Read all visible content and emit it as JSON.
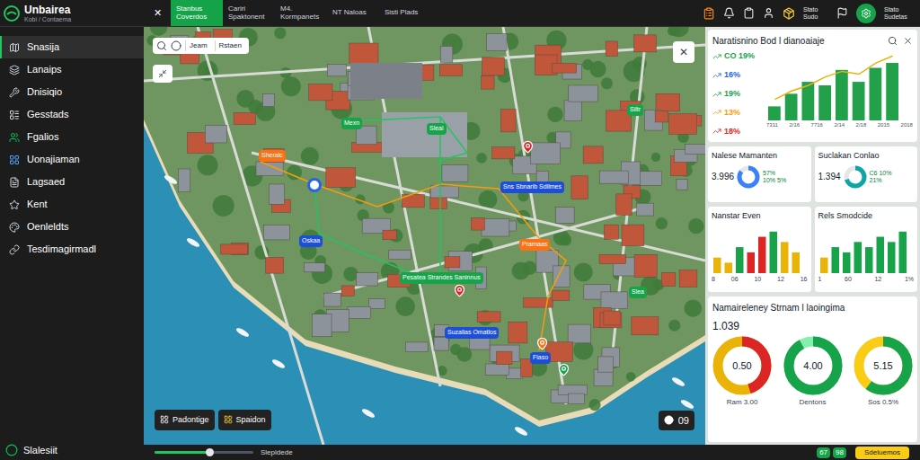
{
  "app": {
    "name": "Unbairea",
    "subtitle": "Kobi / Contaema"
  },
  "toolbar": {
    "close": "✕",
    "tabs": [
      {
        "label": "Stanbus Coverdos",
        "selected": true
      },
      {
        "label": "Cariri Spaktonent",
        "selected": false
      },
      {
        "label": "M4. Kormpanets",
        "selected": false
      },
      {
        "label": "NT Naloas",
        "selected": false
      },
      {
        "label": "Sisti Plads",
        "selected": false
      }
    ],
    "status": "Stato Sudo",
    "user": "Stato Sudetas"
  },
  "sidebar": {
    "items": [
      {
        "label": "Snasija",
        "selected": true
      },
      {
        "label": "Lanaips",
        "selected": false
      },
      {
        "label": "Dnisiqio",
        "selected": false
      },
      {
        "label": "Gesstads",
        "selected": false
      },
      {
        "label": "Fgalios",
        "selected": false
      },
      {
        "label": "Uonajiaman",
        "selected": false
      },
      {
        "label": "Lagsaed",
        "selected": false
      },
      {
        "label": "Kent",
        "selected": false
      },
      {
        "label": "Oenleldts",
        "selected": false
      },
      {
        "label": "Tesdimagirmadl",
        "selected": false
      }
    ],
    "footer": "Slalesiit"
  },
  "map": {
    "tools": [
      "Jeam",
      "Rstaen"
    ],
    "close": "✕",
    "labels": [
      {
        "text": "Sheraic",
        "color": "#f97316"
      },
      {
        "text": "Mexn",
        "color": "#16a34a"
      },
      {
        "text": "Sleal",
        "color": "#16a34a"
      },
      {
        "text": "Siltr",
        "color": "#16a34a"
      },
      {
        "text": "Sns Sbnarib Sdilmes",
        "color": "#1d4ed8"
      },
      {
        "text": "Prarnaas",
        "color": "#f97316"
      },
      {
        "text": "Oskaa",
        "color": "#1d4ed8"
      },
      {
        "text": "Pesatea Strandes Saninnus",
        "color": "#16a34a"
      },
      {
        "text": "Suzalias Omatlos",
        "color": "#1d4ed8"
      },
      {
        "text": "Fiaso",
        "color": "#1d4ed8"
      },
      {
        "text": "Slea",
        "color": "#16a34a"
      }
    ],
    "pins": [
      {
        "color": "#dc2626"
      },
      {
        "color": "#2563eb"
      },
      {
        "color": "#dc2626"
      },
      {
        "color": "#16a34a"
      },
      {
        "color": "#f97316"
      }
    ],
    "buttons": [
      "Padontige",
      "Spaidon"
    ],
    "counter": "09"
  },
  "panel": {
    "trend": {
      "title": "Naratisnino Bod l dianoaiaje",
      "legend": [
        {
          "label": "CO 19%",
          "color": "#16a34a"
        },
        {
          "label": "16%",
          "color": "#2563eb"
        },
        {
          "label": "19%",
          "color": "#16a34a"
        },
        {
          "label": "13%",
          "color": "#f59e0b"
        },
        {
          "label": "18%",
          "color": "#dc2626"
        }
      ],
      "bars": [
        20,
        38,
        55,
        50,
        72,
        55,
        75,
        82
      ],
      "line": [
        30,
        42,
        50,
        62,
        70,
        66,
        82,
        92
      ],
      "max": 100,
      "ticks": [
        "7311",
        "2/16",
        "7716",
        "2/14",
        "2/18",
        "2015",
        "2018"
      ]
    },
    "stats": [
      {
        "title": "Nalese Mamanten",
        "value": "3.996",
        "note": "57% 10% 5%",
        "level": 0.85,
        "color": "#3b82f6"
      },
      {
        "title": "Suclakan Conlao",
        "value": "1.394",
        "note": "C6 10% 21%",
        "level": 0.7,
        "color": "#0ea5a4"
      }
    ],
    "mini_charts": [
      {
        "title": "Nanstar Even",
        "bars": [
          {
            "value": 3,
            "color": "#eab308"
          },
          {
            "value": 2,
            "color": "#eab308"
          },
          {
            "value": 5,
            "color": "#16a34a"
          },
          {
            "value": 4,
            "color": "#dc2626"
          },
          {
            "value": 7,
            "color": "#dc2626"
          },
          {
            "value": 8,
            "color": "#16a34a"
          },
          {
            "value": 6,
            "color": "#eab308"
          },
          {
            "value": 4,
            "color": "#eab308"
          }
        ],
        "max": 9,
        "ticks": [
          "8",
          "06",
          "10",
          "12",
          "16"
        ]
      },
      {
        "title": "Rels Smodcide",
        "bars": [
          {
            "value": 3,
            "color": "#eab308"
          },
          {
            "value": 5,
            "color": "#16a34a"
          },
          {
            "value": 4,
            "color": "#16a34a"
          },
          {
            "value": 6,
            "color": "#16a34a"
          },
          {
            "value": 5,
            "color": "#16a34a"
          },
          {
            "value": 7,
            "color": "#16a34a"
          },
          {
            "value": 6,
            "color": "#16a34a"
          },
          {
            "value": 8,
            "color": "#16a34a"
          }
        ],
        "max": 9,
        "ticks": [
          "1",
          "60",
          "12",
          "1%"
        ]
      }
    ],
    "stream": {
      "title": "Namaireleney Strnam l laoingima",
      "value": "1.039",
      "donuts": [
        {
          "value": "0.50",
          "caption": "Ram 3.00",
          "level": 0.45,
          "color": "#dc2626",
          "track": "#eab308"
        },
        {
          "value": "4.00",
          "caption": "Dentons",
          "level": 0.92,
          "color": "#16a34a",
          "track": "#86efac"
        },
        {
          "value": "5.15",
          "caption": "Sos 0.5%",
          "level": 0.6,
          "color": "#16a34a",
          "track": "#facc15"
        }
      ]
    }
  },
  "footer": {
    "slider": {
      "level": 0.55,
      "label": "Slepidede"
    },
    "counters": [
      "67",
      "98"
    ],
    "action": "Sdeluemos"
  }
}
